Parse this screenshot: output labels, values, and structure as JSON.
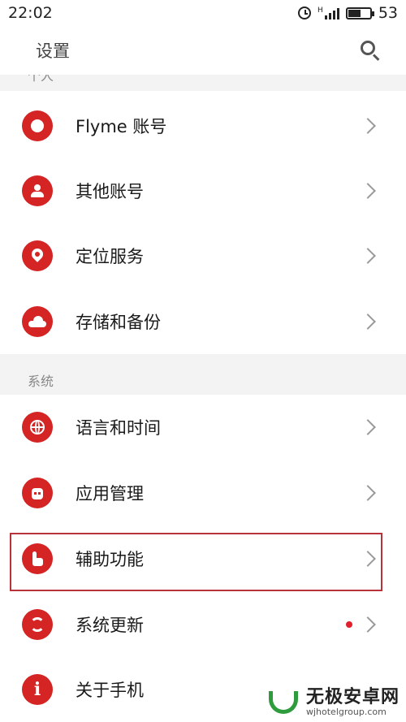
{
  "status": {
    "time": "22:02",
    "network": "H",
    "battery": "53"
  },
  "appbar": {
    "title": "设置"
  },
  "sections": {
    "personal_header_partial": "个人",
    "system_header": "系统"
  },
  "personal_items": [
    {
      "label": "Flyme 账号",
      "icon": "flyme-icon"
    },
    {
      "label": "其他账号",
      "icon": "user-icon"
    },
    {
      "label": "定位服务",
      "icon": "location-pin-icon"
    },
    {
      "label": "存储和备份",
      "icon": "cloud-icon"
    }
  ],
  "system_items": [
    {
      "label": "语言和时间",
      "icon": "globe-icon"
    },
    {
      "label": "应用管理",
      "icon": "android-icon"
    },
    {
      "label": "辅助功能",
      "icon": "hand-pointer-icon"
    },
    {
      "label": "系统更新",
      "icon": "refresh-icon",
      "badge": true
    },
    {
      "label": "关于手机",
      "icon": "info-icon"
    }
  ],
  "colors": {
    "accent": "#d42424",
    "highlight_box": "#b8323a",
    "badge": "#e0202a"
  },
  "watermark": {
    "title": "无极安卓网",
    "url": "wjhotelgroup.com"
  }
}
